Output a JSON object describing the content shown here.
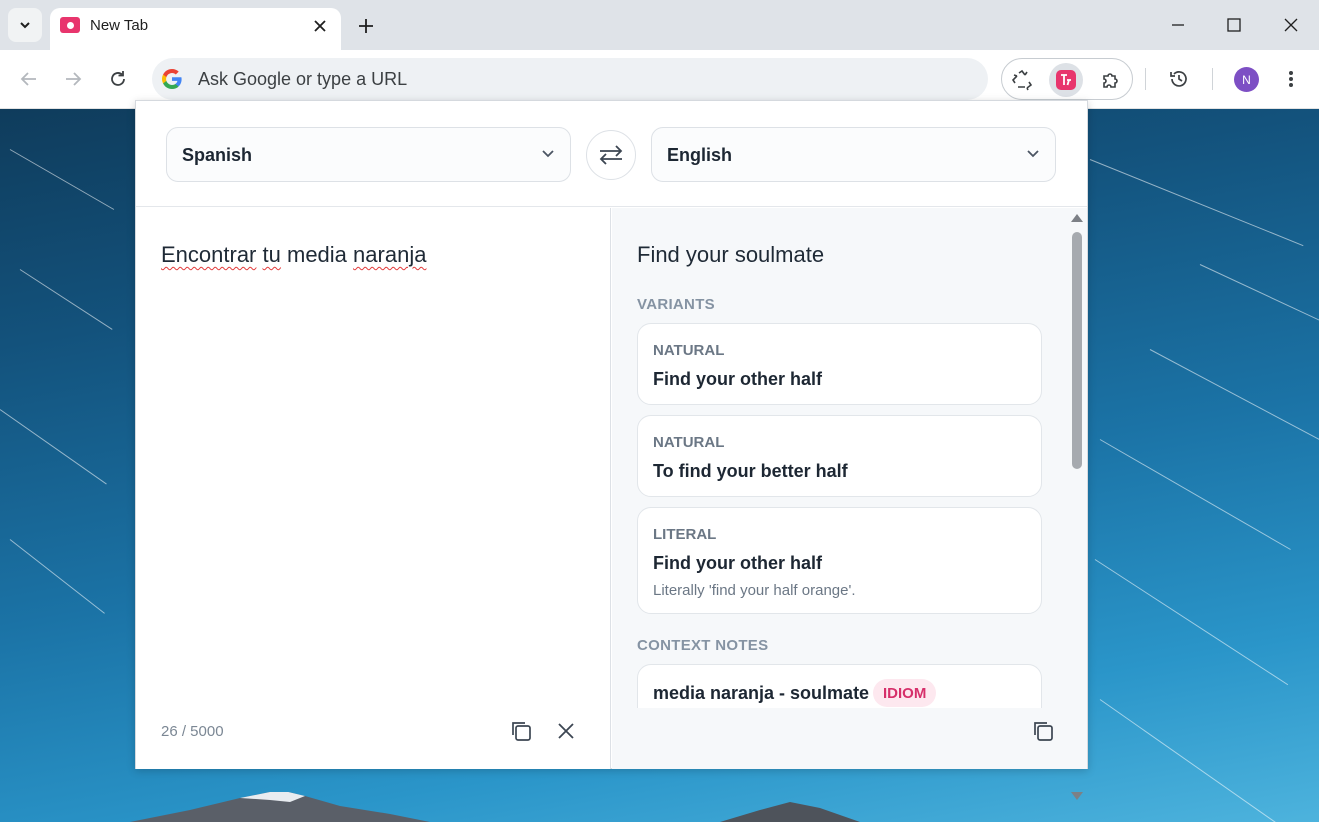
{
  "browser": {
    "tab": {
      "title": "New Tab"
    },
    "omnibox": {
      "placeholder": "Ask Google or type a URL"
    },
    "profile_initial": "N"
  },
  "translator": {
    "source_language": "Spanish",
    "target_language": "English",
    "source_text_words": [
      "Encontrar",
      "tu",
      "media",
      "naranja"
    ],
    "char_counter": "26 / 5000",
    "translation": "Find your soulmate",
    "variants_heading": "VARIANTS",
    "variants": [
      {
        "kind": "NATURAL",
        "text": "Find your other half",
        "note": ""
      },
      {
        "kind": "NATURAL",
        "text": "To find your better half",
        "note": ""
      },
      {
        "kind": "LITERAL",
        "text": "Find your other half",
        "note": "Literally 'find your half orange'."
      }
    ],
    "context_heading": "CONTEXT NOTES",
    "context_notes": [
      {
        "term": "media naranja - soulmate",
        "badge": "IDIOM"
      }
    ]
  },
  "icons": {
    "tab_search": "chevron-down-icon",
    "tab_close": "close-icon",
    "new_tab": "plus-icon",
    "minimize": "minimize-icon",
    "maximize": "maximize-icon",
    "window_close": "close-icon",
    "back": "arrow-left-icon",
    "forward": "arrow-right-icon",
    "reload": "reload-icon",
    "google": "google-g-icon",
    "recycle": "recycle-icon",
    "translator_ext": "translator-extension-icon",
    "extensions": "puzzle-icon",
    "history": "history-icon",
    "menu": "kebab-menu-icon",
    "swap": "swap-icon",
    "copy": "copy-icon",
    "clear": "clear-icon"
  },
  "colors": {
    "accent_pink": "#e8356d",
    "badge_bg": "#fde8ef",
    "badge_text": "#d62f6a",
    "avatar": "#7d4fc4"
  }
}
